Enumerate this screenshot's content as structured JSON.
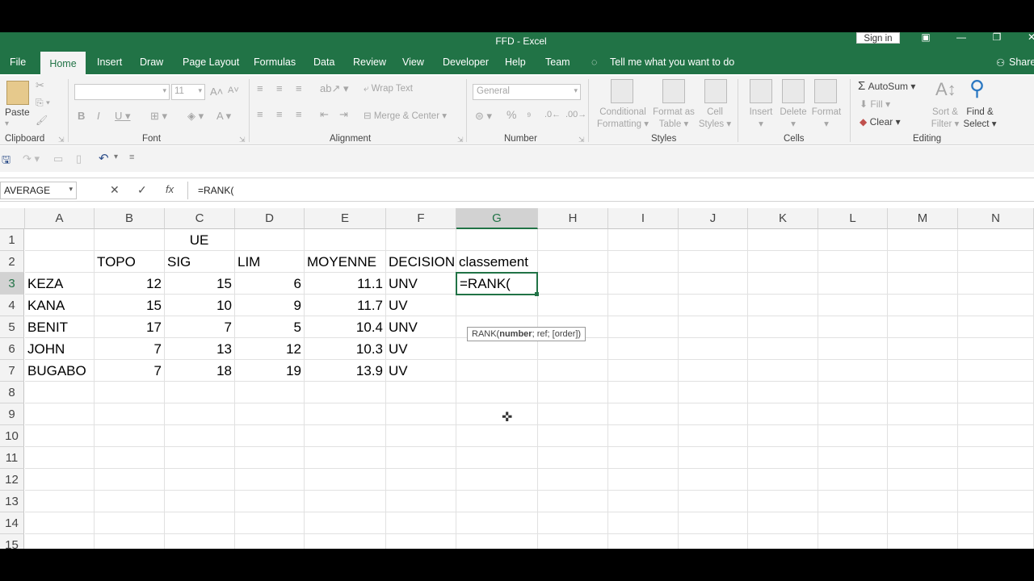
{
  "window": {
    "title": "FFD  -  Excel",
    "sign_in": "Sign in",
    "share": "Share",
    "restore_icon": "restore-icon",
    "minimize": "—",
    "maximize": "❐",
    "close": "✕"
  },
  "menu": [
    "File",
    "Home",
    "Insert",
    "Draw",
    "Page Layout",
    "Formulas",
    "Data",
    "Review",
    "View",
    "Developer",
    "Help",
    "Team"
  ],
  "tell_me": "Tell me what you want to do",
  "ribbon": {
    "clipboard": {
      "paste": "Paste",
      "label": "Clipboard"
    },
    "font": {
      "size": "11",
      "label": "Font"
    },
    "alignment": {
      "wrap_text": "Wrap Text",
      "merge_center": "Merge & Center",
      "label": "Alignment"
    },
    "number": {
      "format": "General",
      "percent": "%",
      "label": "Number"
    },
    "styles": {
      "conditional_formatting": [
        "Conditional",
        "Formatting"
      ],
      "format_as_table": [
        "Format as",
        "Table"
      ],
      "cell_styles": [
        "Cell",
        "Styles"
      ],
      "label": "Styles"
    },
    "cells": {
      "insert": "Insert",
      "delete": "Delete",
      "format": "Format",
      "label": "Cells"
    },
    "editing": {
      "autosum": "AutoSum",
      "fill": "Fill",
      "clear": "Clear",
      "sort_filter": [
        "Sort &",
        "Filter"
      ],
      "find_select": [
        "Find &",
        "Select"
      ],
      "label": "Editing"
    }
  },
  "formula_bar": {
    "name_box": "AVERAGE",
    "cancel": "✕",
    "enter": "✓",
    "fx": "fx",
    "formula": "=RANK("
  },
  "columns": [
    "A",
    "B",
    "C",
    "D",
    "E",
    "F",
    "G",
    "H",
    "I",
    "J",
    "K",
    "L",
    "M",
    "N"
  ],
  "rows": [
    "1",
    "2",
    "3",
    "4",
    "5",
    "6",
    "7",
    "8",
    "9",
    "10",
    "11",
    "12",
    "13",
    "14",
    "15"
  ],
  "sheet": {
    "row1": {
      "C": "UE"
    },
    "row2": [
      "",
      "TOPO",
      "SIG",
      "LIM",
      "MOYENNE",
      "DECISION",
      "classement"
    ],
    "data": [
      [
        "KEZA",
        "12",
        "15",
        "6",
        "11.1",
        "UNV"
      ],
      [
        "KANA",
        "15",
        "10",
        "9",
        "11.7",
        "UV"
      ],
      [
        "BENIT",
        "17",
        "7",
        "5",
        "10.4",
        "UNV"
      ],
      [
        "JOHN",
        "7",
        "13",
        "12",
        "10.3",
        "UV"
      ],
      [
        "BUGABO",
        "7",
        "18",
        "19",
        "13.9",
        "UV"
      ]
    ],
    "active_cell_value": "=RANK(",
    "tooltip": {
      "fn": "RANK(",
      "arg_bold": "number",
      "rest": "; ref; [order])"
    }
  },
  "colors": {
    "accent": "#217346"
  }
}
